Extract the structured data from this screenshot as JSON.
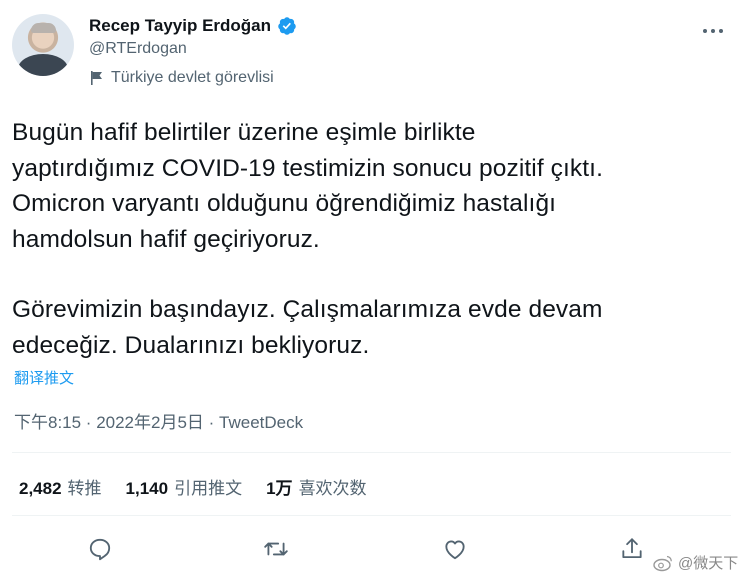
{
  "header": {
    "display_name": "Recep Tayyip Erdoğan",
    "handle": "@RTErdogan",
    "label": "Türkiye devlet görevlisi"
  },
  "tweet": {
    "lines_paragraph1": [
      "Bugün hafif belirtiler üzerine eşimle birlikte",
      "yaptırdığımız COVID-19 testimizin sonucu pozitif çıktı.",
      "Omicron varyantı olduğunu öğrendiğimiz hastalığı",
      "hamdolsun hafif geçiriyoruz."
    ],
    "lines_paragraph2": [
      "Görevimizin başındayız. Çalışmalarımıza evde devam",
      "edeceğiz. Dualarınızı bekliyoruz."
    ],
    "translate_label": "翻译推文",
    "meta": "下午8:15 · 2022年2月5日 · TweetDeck"
  },
  "stats": [
    {
      "count": "2,482",
      "label": "转推"
    },
    {
      "count": "1,140",
      "label": "引用推文"
    },
    {
      "count": "1万",
      "label": "喜欢次数"
    }
  ],
  "watermark": "@微天下",
  "icons": {
    "verified": "verified-badge-icon",
    "label": "flag-icon",
    "more": "more-icon",
    "reply": "reply-icon",
    "retweet": "retweet-icon",
    "like": "heart-icon",
    "share": "share-icon"
  },
  "colors": {
    "accent": "#1d9bf0",
    "text": "#0f1419",
    "secondary": "#536471"
  }
}
